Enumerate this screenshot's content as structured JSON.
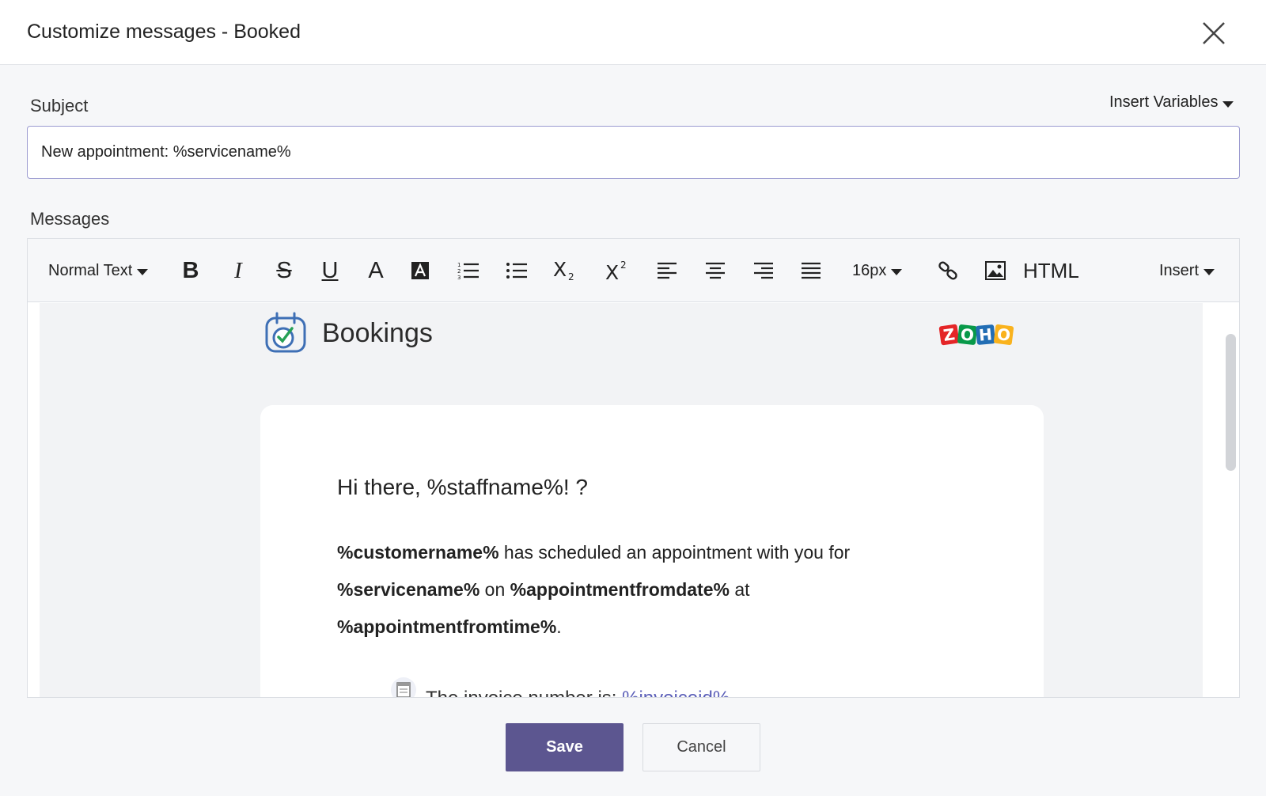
{
  "header": {
    "title": "Customize messages - Booked"
  },
  "subject": {
    "label": "Subject",
    "value": "New appointment: %servicename%",
    "insert_variables": "Insert Variables"
  },
  "messages": {
    "label": "Messages",
    "toolbar": {
      "format": "Normal Text",
      "size": "16px",
      "html": "HTML",
      "insert": "Insert"
    },
    "brand": "Bookings",
    "zoho_letters": [
      "Z",
      "O",
      "H",
      "O"
    ],
    "zoho_colors": [
      "#e42527",
      "#089949",
      "#226db4",
      "#f9b21d"
    ],
    "greeting": "Hi there, %staffname%! ?",
    "body": {
      "customer": "%customername%",
      "t1": " has scheduled an appointment with you for ",
      "service": "%servicename%",
      "t2": " on ",
      "date": "%appointmentfromdate%",
      "t3": " at ",
      "time": "%appointmentfromtime%",
      "t4": "."
    },
    "invoice_text": "The invoice number is: ",
    "invoice_var": "%invoiceid%"
  },
  "footer": {
    "save": "Save",
    "cancel": "Cancel"
  },
  "colors": {
    "primary": "#5c5690",
    "input_border": "#9b9ad0",
    "link": "#5b5fb8"
  }
}
